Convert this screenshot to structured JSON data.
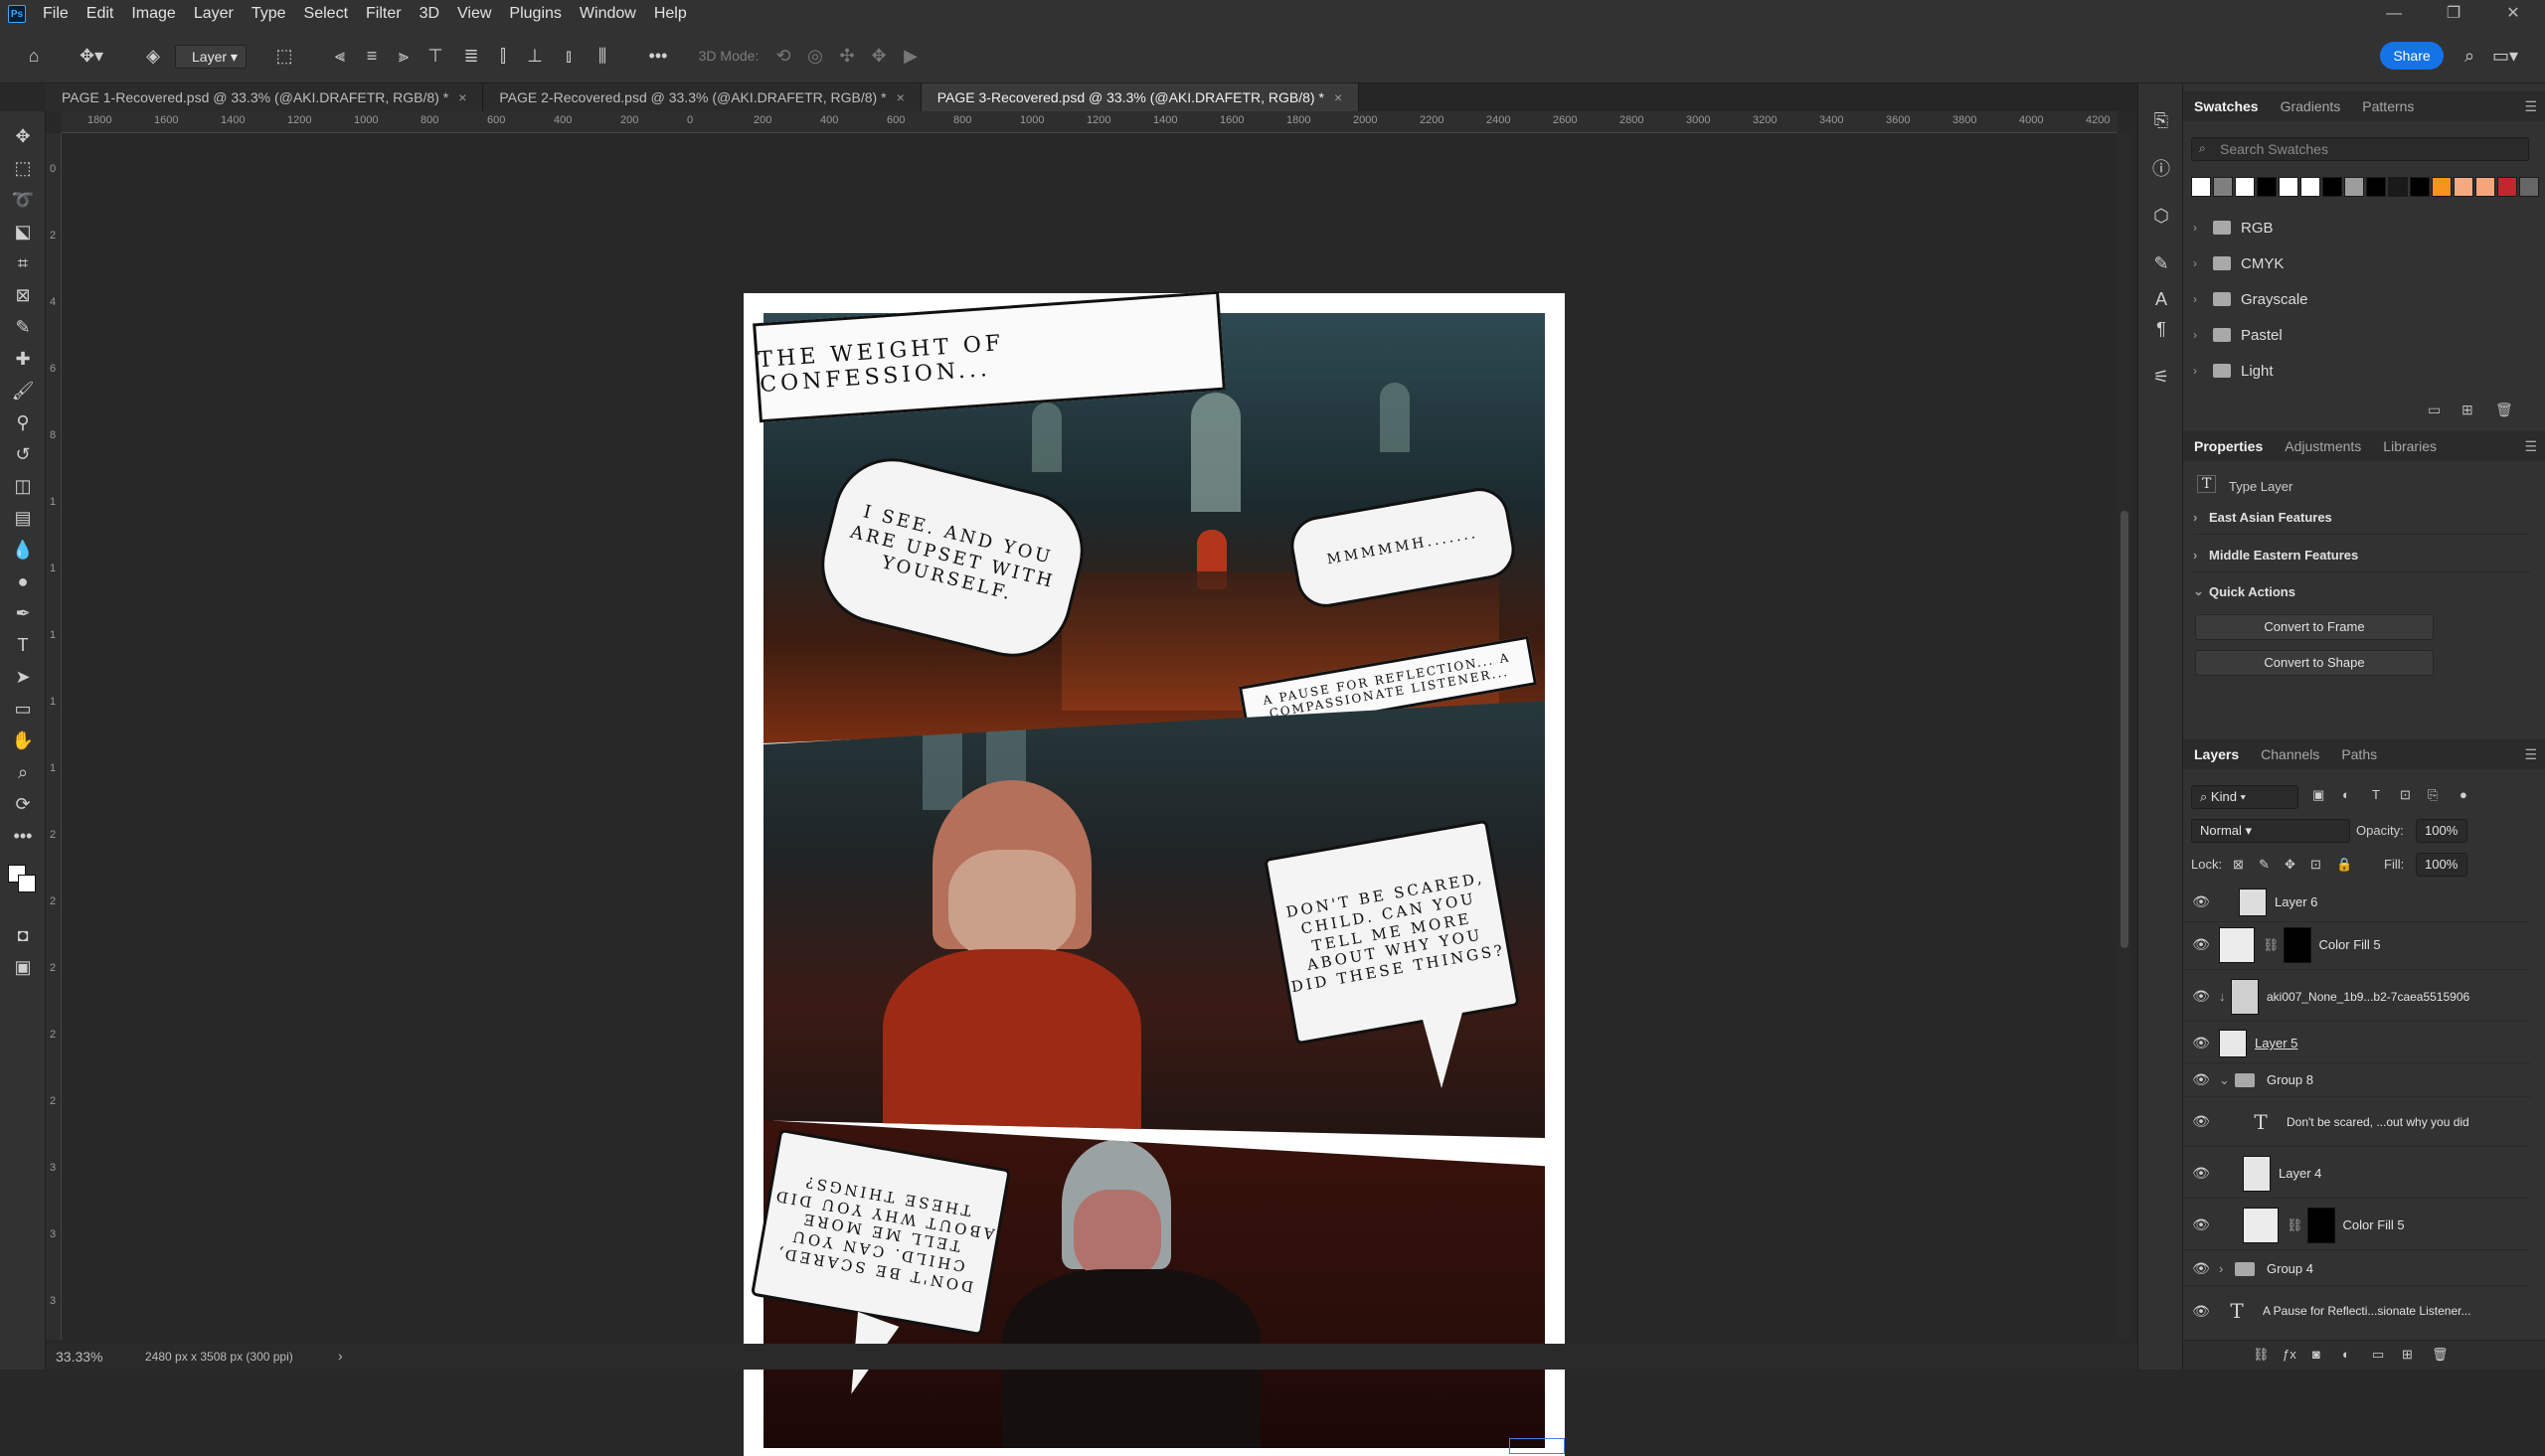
{
  "menu": {
    "logo": "Ps",
    "items": [
      "File",
      "Edit",
      "Image",
      "Layer",
      "Type",
      "Select",
      "Filter",
      "3D",
      "View",
      "Plugins",
      "Window",
      "Help"
    ]
  },
  "window_controls": {
    "minimize": "—",
    "maximize": "❐",
    "close": "✕"
  },
  "options": {
    "auto_select_value": "Layer",
    "mode_label": "3D Mode:",
    "share_label": "Share"
  },
  "tabs": [
    {
      "label": "PAGE 1-Recovered.psd @ 33.3% (@AKI.DRAFETR, RGB/8) *",
      "close": "×"
    },
    {
      "label": "PAGE 2-Recovered.psd @ 33.3% (@AKI.DRAFETR, RGB/8) *",
      "close": "×"
    },
    {
      "label": "PAGE 3-Recovered.psd @ 33.3% (@AKI.DRAFETR, RGB/8) *",
      "close": "×"
    }
  ],
  "ruler_h": [
    "1800",
    "1600",
    "1400",
    "1200",
    "1000",
    "800",
    "600",
    "400",
    "200",
    "0",
    "200",
    "400",
    "600",
    "800",
    "1000",
    "1200",
    "1400",
    "1600",
    "1800",
    "2000",
    "2200",
    "2400",
    "2600",
    "2800",
    "3000",
    "3200",
    "3400",
    "3600",
    "3800",
    "4000",
    "4200"
  ],
  "ruler_v": [
    "0",
    "2",
    "4",
    "6",
    "8",
    "1",
    "1",
    "1",
    "1",
    "1",
    "2",
    "2",
    "2",
    "2",
    "2",
    "3",
    "3",
    "3"
  ],
  "comic": {
    "title_caption": "THE WEIGHT OF CONFESSION...",
    "bubble1": "I SEE. AND YOU ARE UPSET WITH YOURSELF.",
    "bubble2": "MMMMMH.......",
    "caption2": "A PAUSE FOR REFLECTION... A COMPASSIONATE LISTENER...",
    "bubble3": "DON'T BE SCARED, CHILD. CAN YOU TELL ME MORE ABOUT WHY YOU DID THESE THINGS?",
    "bubble4_mirrored": "DON'T BE SCARED, CHILD. CAN YOU TELL ME MORE ABOUT WHY YOU DID THESE THINGS?"
  },
  "status": {
    "zoom": "33.33%",
    "doc_info": "2480 px x 3508 px (300 ppi)",
    "arrow": "›"
  },
  "swatches_panel": {
    "tabs": [
      "Swatches",
      "Gradients",
      "Patterns"
    ],
    "search_placeholder": "Search Swatches",
    "colors": [
      "#ffffff",
      "#7f7f7f",
      "#ffffff",
      "#000000",
      "#ffffff",
      "#ffffff",
      "#000000",
      "#9d9d9d",
      "#000000",
      "#1a1a1a",
      "#000000",
      "#f7941d",
      "#f5a97f",
      "#f4a57c",
      "#c1272d",
      "#666666"
    ],
    "folders": [
      "RGB",
      "CMYK",
      "Grayscale",
      "Pastel",
      "Light"
    ]
  },
  "properties_panel": {
    "tabs": [
      "Properties",
      "Adjustments",
      "Libraries"
    ],
    "layer_kind": "Type Layer",
    "sections": [
      "East Asian Features",
      "Middle Eastern Features",
      "Quick Actions"
    ],
    "buttons": [
      "Convert to Frame",
      "Convert to Shape"
    ]
  },
  "layers_panel": {
    "tabs": [
      "Layers",
      "Channels",
      "Paths"
    ],
    "kind_label": "Kind",
    "blend_mode": "Normal",
    "opacity_label": "Opacity:",
    "opacity_value": "100%",
    "lock_label": "Lock:",
    "fill_label": "Fill:",
    "fill_value": "100%",
    "layers": [
      {
        "name": "Layer 6",
        "type": "pixel"
      },
      {
        "name": "Color Fill 5",
        "type": "fill"
      },
      {
        "name": "aki007_None_1b9...b2-7caea5515906",
        "type": "smart"
      },
      {
        "name": "Layer 5",
        "type": "pixel"
      },
      {
        "name": "Group 8",
        "type": "group"
      },
      {
        "name": "Don't be scared, ...out why you did",
        "type": "text"
      },
      {
        "name": "Layer 4",
        "type": "pixel"
      },
      {
        "name": "Color Fill 5",
        "type": "fill"
      },
      {
        "name": "Group 4",
        "type": "group"
      },
      {
        "name": "A Pause for Reflecti...sionate Listener...",
        "type": "text"
      }
    ]
  }
}
